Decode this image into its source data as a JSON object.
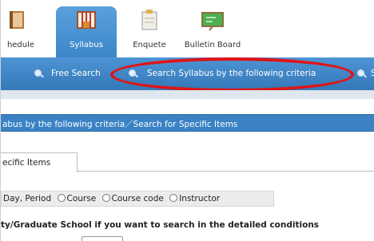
{
  "topnav": {
    "tabs": [
      {
        "label": "hedule",
        "icon": "schedule-book-icon"
      },
      {
        "label": "Syllabus",
        "icon": "syllabus-icon",
        "active": true
      },
      {
        "label": "Enquete",
        "icon": "enquete-clipboard-icon"
      },
      {
        "label": "Bulletin Board",
        "icon": "bulletin-board-icon"
      }
    ]
  },
  "searchbar": {
    "free_search": "Free Search",
    "criteria_search": "Search Syllabus by the following criteria",
    "cut_item": "S"
  },
  "titlebar": {
    "text": "abus by the following criteria／Search for Specific Items"
  },
  "tabs": {
    "specific_items": "ecific Items"
  },
  "criteria": {
    "prefix": "Day, Period",
    "options": [
      "Course",
      "Course code",
      "Instructor"
    ]
  },
  "notice": "ty/Graduate School if you want to search in the detailed conditions",
  "colors": {
    "nav_blue": "#3c86c8",
    "highlight_red": "#e01414"
  }
}
